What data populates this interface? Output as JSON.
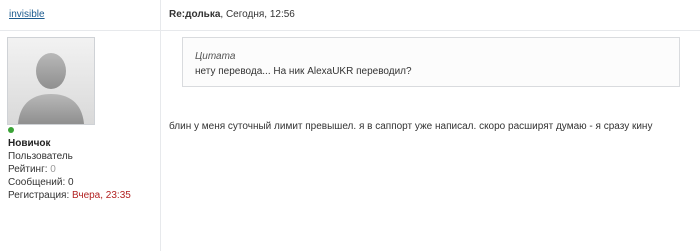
{
  "header": {
    "username": "invisible",
    "post_title_prefix": "Re:",
    "post_title_subject": "долька",
    "post_date": ", Сегодня, 12:56"
  },
  "profile": {
    "rank": "Новичок",
    "group": "Пользователь",
    "rating_label": "Рейтинг: ",
    "rating_value": "0",
    "posts_label": "Сообщений: ",
    "posts_value": "0",
    "reg_label": "Регистрация: ",
    "reg_value": "Вчера, 23:35"
  },
  "quote": {
    "title": "Цитата",
    "text": "нету перевода... На ник AlexaUKR переводил?"
  },
  "post": {
    "body": "блин у меня суточный лимит превышел. я в саппорт уже написал. скоро расширят думаю - я сразу кину"
  },
  "colors": {
    "link": "#1c5b8f",
    "online": "#3aa336",
    "reg_value": "#b22222",
    "muted": "#999999",
    "border": "#e7e9ec"
  },
  "icons": {
    "avatar": "default-user-silhouette-icon",
    "online": "online-status-dot"
  }
}
